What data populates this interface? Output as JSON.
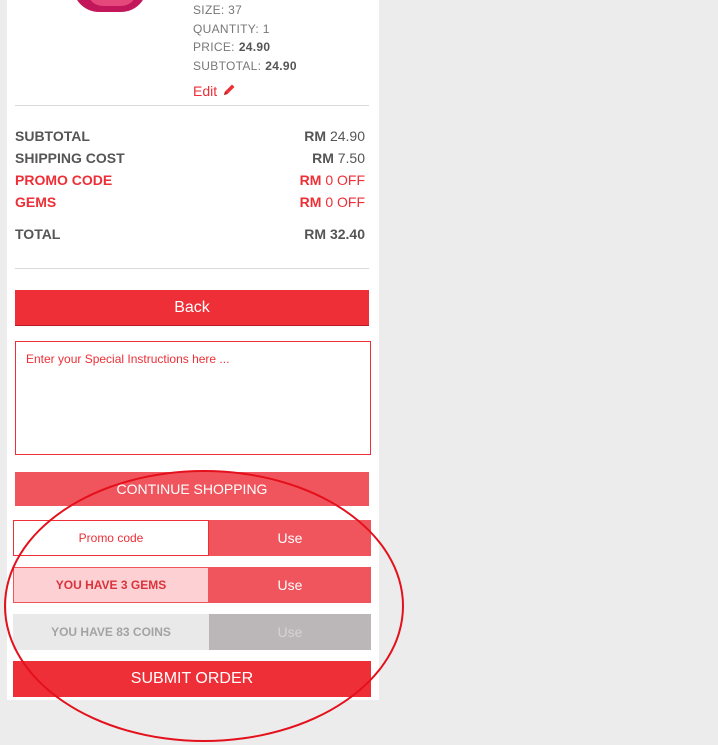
{
  "product": {
    "size_label": "SIZE:",
    "size_value": "37",
    "quantity_label": "QUANTITY:",
    "quantity_value": "1",
    "price_label": "PRICE:",
    "price_value": "24.90",
    "subtotal_label": "SUBTOTAL:",
    "subtotal_value": "24.90",
    "edit_label": "Edit",
    "edit_icon": "pencil-icon"
  },
  "summary": {
    "subtotal_label": "SUBTOTAL",
    "subtotal_currency": "RM",
    "subtotal_value": "24.90",
    "shipping_label": "SHIPPING COST",
    "shipping_currency": "RM",
    "shipping_value": "7.50",
    "promo_label": "PROMO CODE",
    "promo_currency": "RM",
    "promo_value": "0 OFF",
    "gems_label": "GEMS",
    "gems_currency": "RM",
    "gems_value": "0 OFF",
    "total_label": "TOTAL",
    "total_currency": "RM",
    "total_value": "32.40"
  },
  "actions": {
    "back_label": "Back",
    "instructions_placeholder": "Enter your Special Instructions here ...",
    "continue_label": "CONTINUE SHOPPING",
    "promo_placeholder": "Promo code",
    "promo_use_label": "Use",
    "gems_text": "YOU HAVE 3 GEMS",
    "gems_use_label": "Use",
    "coins_text": "YOU HAVE 83 COINS",
    "coins_use_label": "Use",
    "submit_label": "SUBMIT ORDER"
  },
  "colors": {
    "accent": "#ee2f37",
    "accent_light": "#f0555d",
    "gems_bg": "#fdd0d3",
    "disabled": "#bbb6b7",
    "annotation": "#e4101b"
  }
}
